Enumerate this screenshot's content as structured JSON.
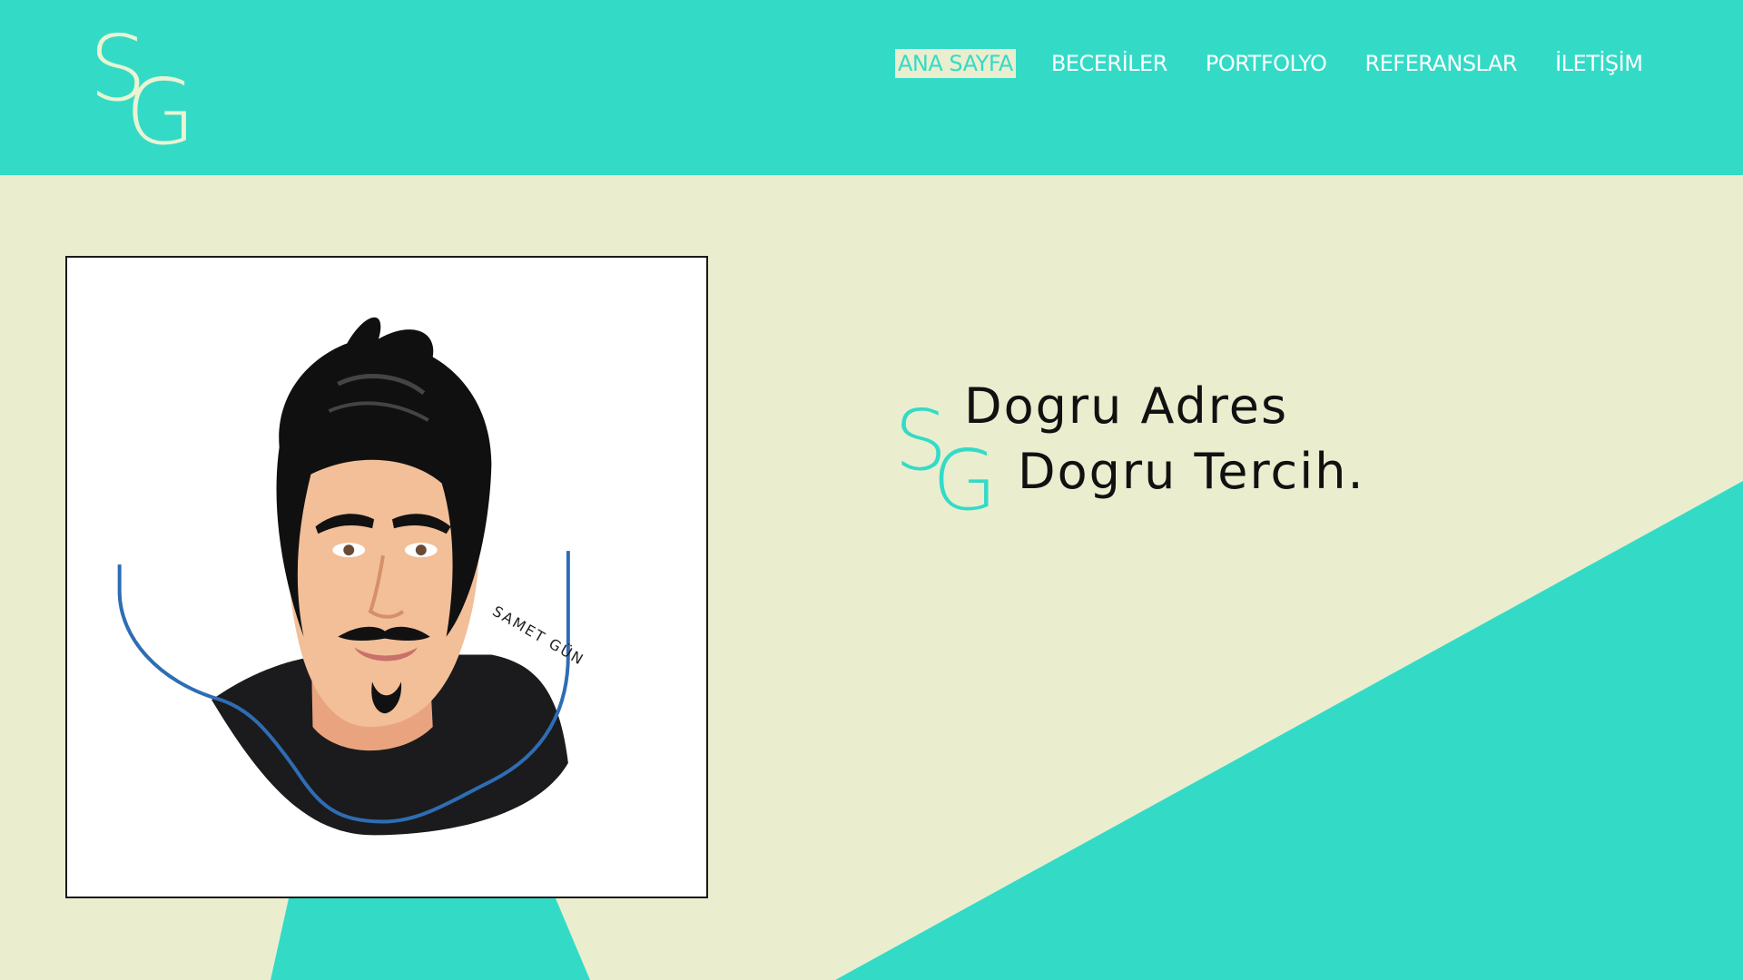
{
  "brand": {
    "logo_letter_1": "S",
    "logo_letter_2": "G",
    "accent_color": "#33dbc7",
    "background_color": "#eaeecf"
  },
  "nav": {
    "items": [
      {
        "label": "ANA SAYFA",
        "active": true
      },
      {
        "label": "BECERİLER",
        "active": false
      },
      {
        "label": "PORTFOLYO",
        "active": false
      },
      {
        "label": "REFERANSLAR",
        "active": false
      },
      {
        "label": "İLETİŞİM",
        "active": false
      }
    ]
  },
  "hero": {
    "portrait_signature": "SAMET GÜN",
    "tagline_line_1": "Dogru Adres",
    "tagline_line_2": "Dogru Tercih.",
    "tagline_mark_1": "S",
    "tagline_mark_2": "G"
  }
}
